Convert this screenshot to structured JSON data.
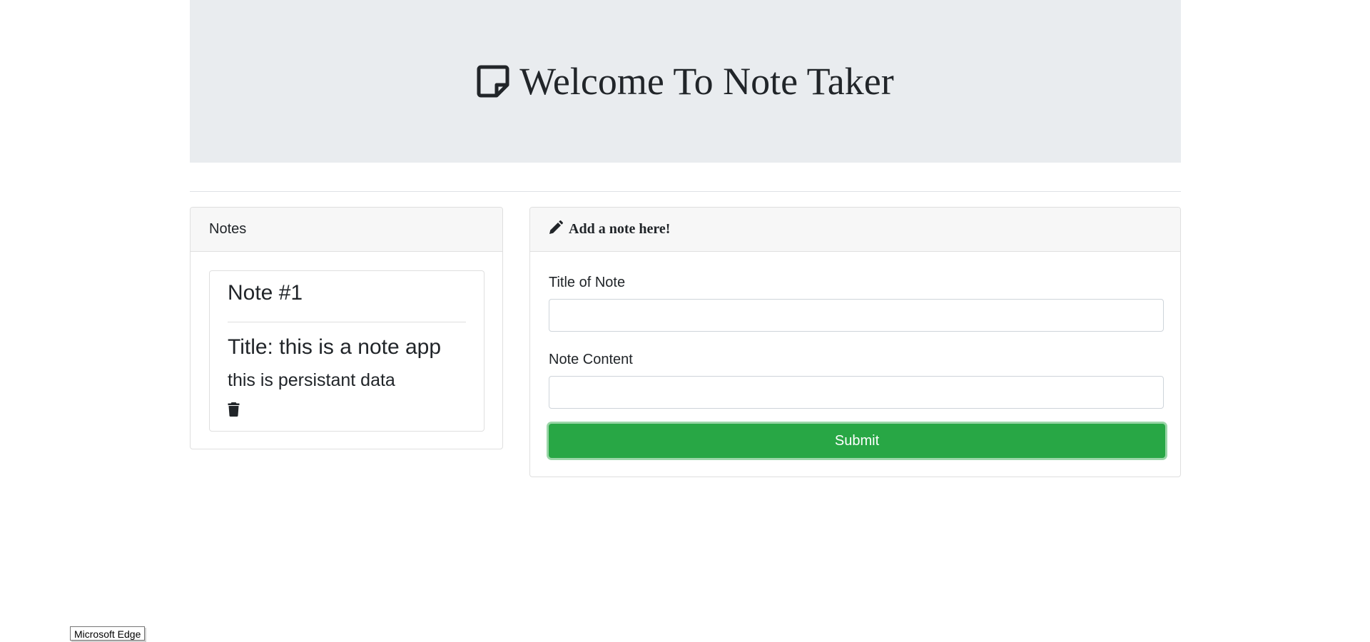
{
  "header": {
    "title": "Welcome To Note Taker",
    "icon": "sticky-note-icon"
  },
  "notes_panel": {
    "header": "Notes",
    "notes": [
      {
        "heading": "Note #1",
        "title": "Title: this is a note app",
        "content": "this is persistant data",
        "delete_icon": "trash-icon"
      }
    ]
  },
  "form_panel": {
    "header": "Add a note here!",
    "header_icon": "pencil-icon",
    "title_label": "Title of Note",
    "title_value": "",
    "content_label": "Note Content",
    "content_value": "",
    "submit_label": "Submit"
  },
  "tooltip": {
    "text": "Microsoft Edge"
  },
  "colors": {
    "jumbotron_bg": "#e9ecef",
    "card_header_bg": "#f7f7f7",
    "submit_bg": "#28a745",
    "text": "#212529"
  }
}
